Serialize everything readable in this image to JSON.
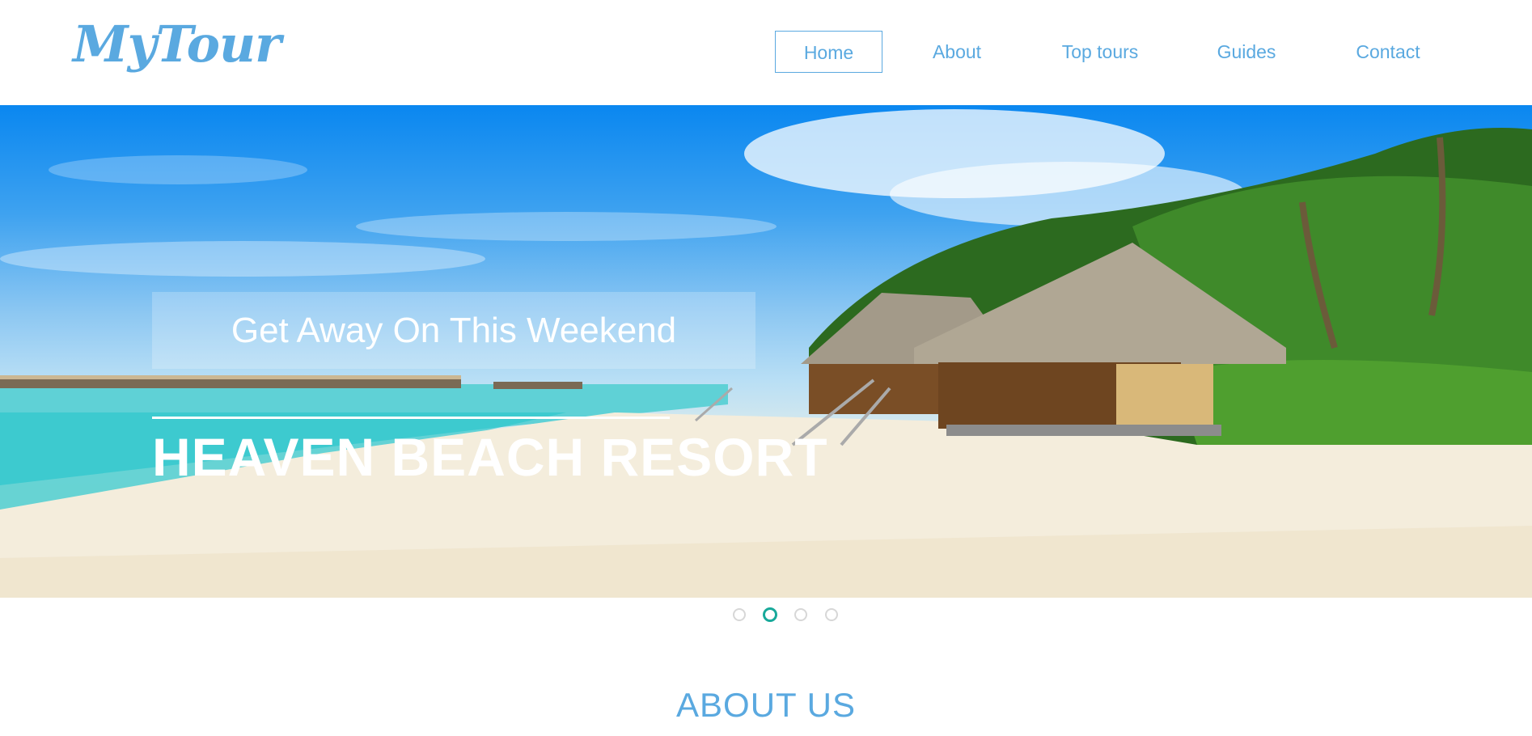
{
  "brand": {
    "logo": "MyTour"
  },
  "nav": {
    "items": [
      {
        "label": "Home",
        "active": true
      },
      {
        "label": "About",
        "active": false
      },
      {
        "label": "Top tours",
        "active": false
      },
      {
        "label": "Guides",
        "active": false
      },
      {
        "label": "Contact",
        "active": false
      }
    ]
  },
  "hero": {
    "tagline": "Get Away On This Weekend",
    "title": "HEAVEN BEACH RESORT",
    "image": "beach-resort-photo"
  },
  "carousel": {
    "slide_count": 4,
    "active_slide": 2
  },
  "about": {
    "heading": "ABOUT US"
  },
  "colors": {
    "brand": "#5aa9e0",
    "dot_active": "#18a99a",
    "dot_inactive": "#d7d7d7"
  }
}
